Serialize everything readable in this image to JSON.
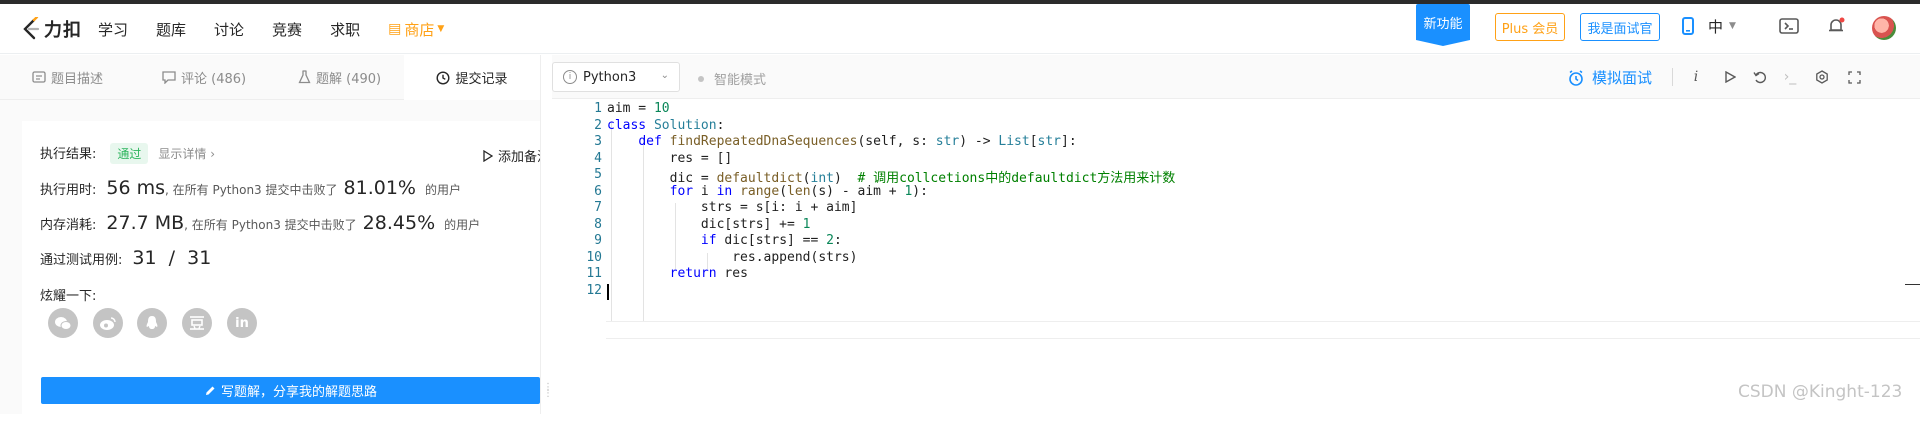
{
  "brand": {
    "name": "力扣"
  },
  "nav": {
    "links": [
      "学习",
      "题库",
      "讨论",
      "竞赛",
      "求职"
    ],
    "store_label": "商店",
    "new_feature_label": "新功能",
    "plus_label": "Plus 会员",
    "interviewer_label": "我是面试官",
    "language_label": "中",
    "icons": [
      "mobile-icon",
      "playground-icon",
      "bell-icon"
    ]
  },
  "tabs": [
    {
      "label": "题目描述",
      "icon": "description-icon"
    },
    {
      "label": "评论 (486)",
      "icon": "comment-icon"
    },
    {
      "label": "题解 (490)",
      "icon": "flask-icon"
    },
    {
      "label": "提交记录",
      "icon": "clock-icon",
      "active": true
    }
  ],
  "result": {
    "status_label": "执行结果:",
    "status_value": "通过",
    "detail_link": "显示详情",
    "add_note": "添加备注",
    "runtime_label": "执行用时:",
    "runtime_value": "56 ms",
    "runtime_text": ", 在所有 Python3 提交中击败了",
    "runtime_pct": "81.01%",
    "runtime_suffix": "的用户",
    "memory_label": "内存消耗:",
    "memory_value": "27.7 MB",
    "memory_text": ", 在所有 Python3 提交中击败了",
    "memory_pct": "28.45%",
    "memory_suffix": "的用户",
    "tests_label": "通过测试用例:",
    "tests_value": "31  /  31",
    "share_label": "炫耀一下:",
    "share_icons": [
      "wechat-icon",
      "weibo-icon",
      "qq-icon",
      "douban-icon",
      "linkedin-icon"
    ],
    "write_solution_label": "写题解，分享我的解题思路"
  },
  "editor": {
    "language": "Python3",
    "smart_mode_label": "智能模式",
    "mock_interview_label": "模拟面试",
    "toolbar_icons": [
      "info-icon",
      "run-icon",
      "reset-icon",
      "console-icon",
      "settings-icon",
      "fullscreen-icon"
    ],
    "line_numbers": [
      "1",
      "2",
      "3",
      "4",
      "5",
      "6",
      "7",
      "8",
      "9",
      "10",
      "11",
      "12"
    ],
    "code_lines": [
      "aim = 10",
      "class Solution:",
      "    def findRepeatedDnaSequences(self, s: str) -> List[str]:",
      "        res = []",
      "        dic = defaultdict(int)  # 调用collcetions中的defaultdict方法用来计数",
      "        for i in range(len(s) - aim + 1):",
      "            strs = s[i: i + aim]",
      "            dic[strs] += 1",
      "            if dic[strs] == 2:",
      "                res.append(strs)",
      "        return res",
      ""
    ]
  },
  "watermark": "CSDN @Kinght-123",
  "colors": {
    "accent": "#1a90ff",
    "store": "#ffa116",
    "pass": "#2db55d"
  }
}
